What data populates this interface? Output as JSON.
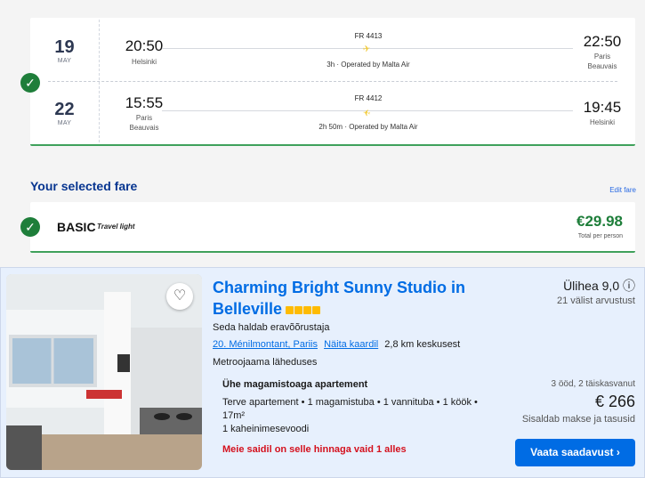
{
  "flights": [
    {
      "day": "19",
      "month": "MAY",
      "dep_time": "20:50",
      "dep_city": "Helsinki",
      "arr_time": "22:50",
      "arr_city": "Paris\nBeauvais",
      "flight": "FR 4413",
      "info": "3h · Operated by Malta Air"
    },
    {
      "day": "22",
      "month": "MAY",
      "dep_time": "15:55",
      "dep_city": "Paris\nBeauvais",
      "arr_time": "19:45",
      "arr_city": "Helsinki",
      "flight": "FR 4412",
      "info": "2h 50m · Operated by Malta Air"
    }
  ],
  "fare": {
    "title": "Your selected fare",
    "edit": "Edit fare",
    "name": "BASIC",
    "tag": "Travel light",
    "price": "€29.98",
    "per": "Total per person"
  },
  "hotel": {
    "name": "Charming Bright Sunny Studio in Belleville",
    "managed": "Seda haldab eravõõrustaja",
    "location": "20. Ménilmontant, Pariis",
    "map": "Näita kaardil",
    "distance": "2,8 km keskusest",
    "metro": "Metroojaama läheduses",
    "score": "Ülihea 9,0",
    "reviews": "21 välist arvustust",
    "apt_title": "Ühe magamistoaga apartement",
    "apt_desc": "Terve apartement • 1 magamistuba • 1 vannituba • 1 köök • 17m²",
    "bed": "1 kaheinimesevoodi",
    "warning": "Meie saidil on selle hinnaga vaid 1 alles",
    "nights": "3 ööd, 2 täiskasvanut",
    "price": "€ 266",
    "taxes": "Sisaldab makse ja tasusid",
    "button": "Vaata saadavust",
    "stars": 4
  },
  "colors": {
    "primary": "#006ce4",
    "green": "#1e7e3a",
    "warning": "#d4111e"
  }
}
